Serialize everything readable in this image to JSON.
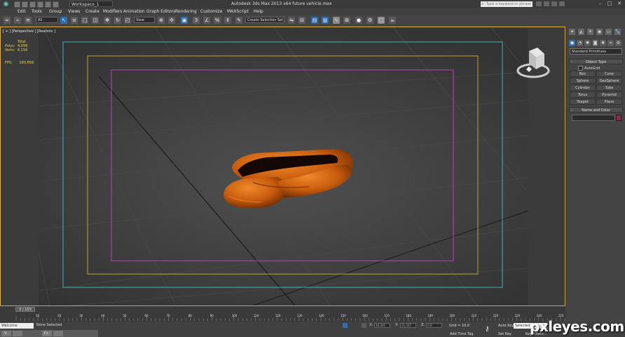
{
  "titlebar": {
    "workspace": "Workspace_1",
    "title": "Autodesk 3ds Max  2013 x64      future vehicle.max",
    "search_placeholder": "Type a keyword or phrase"
  },
  "menu": [
    "Edit",
    "Tools",
    "Group",
    "Views",
    "Create",
    "Modifiers",
    "Animation",
    "Graph Editors",
    "Rendering",
    "Customize",
    "MAXScript",
    "Help"
  ],
  "toolbar": {
    "selection_filter": "All",
    "reference_coord": "View",
    "named_selection": "Create Selection Set"
  },
  "viewport": {
    "label": "[ + ] [Perspective ] [Realistic ]",
    "stats": {
      "header": "Total",
      "polys_label": "Polys:",
      "polys_value": "4,099",
      "verts_label": "Verts:",
      "verts_value": "6,156"
    },
    "fps_label": "FPS:",
    "fps_value": "160.858"
  },
  "command_panel": {
    "primitive_type": "Standard Primitives",
    "object_type_title": "Object Type",
    "autogrid_label": "AutoGrid",
    "objects": [
      "Box",
      "Cone",
      "Sphere",
      "GeoSphere",
      "Cylinder",
      "Tube",
      "Torus",
      "Pyramid",
      "Teapot",
      "Plane"
    ],
    "name_color_title": "Name and Color",
    "object_color": "#a0214b"
  },
  "timeline": {
    "frame_range": "0 / 150",
    "ticks": [
      "10",
      "20",
      "30",
      "40",
      "50",
      "60",
      "70",
      "80",
      "90",
      "100",
      "110",
      "120",
      "130",
      "140",
      "150",
      "160",
      "170",
      "180",
      "190",
      "200",
      "210",
      "220",
      "230",
      "240",
      "250"
    ]
  },
  "statusbar": {
    "maxscript_text": "Welcome",
    "selection_status": "None Selected",
    "x_label": "X:",
    "x_value": "16.341",
    "y_label": "Y:",
    "y_value": "11.337",
    "z_label": "Z:",
    "z_value": "0.0",
    "grid_label": "Grid = 10.0",
    "add_time_tag": "Add Time Tag",
    "auto_key": "Auto Key",
    "set_key": "Set Key",
    "selected": "Selected",
    "key_filters": "Key Filters...",
    "taskbar_items": [
      "V..",
      "",
      "Cr..",
      ""
    ]
  },
  "watermark": "pxleyes.com"
}
